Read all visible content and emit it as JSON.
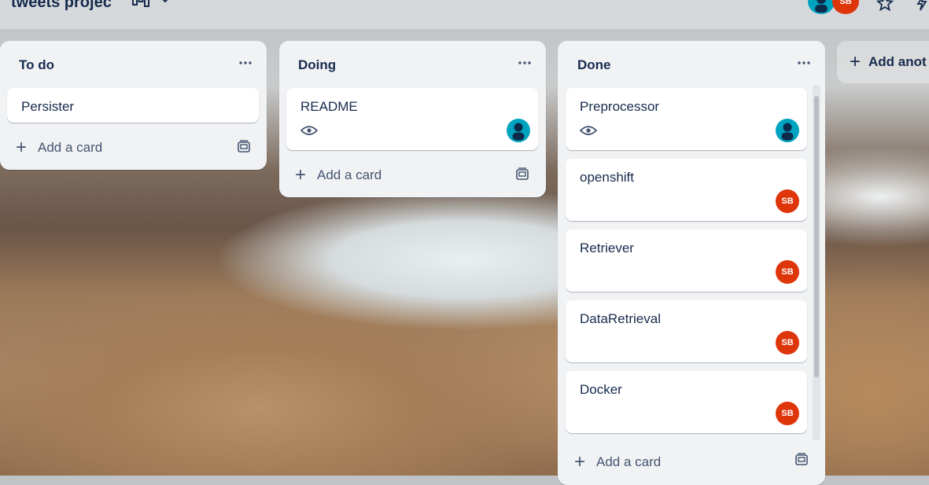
{
  "header": {
    "board_title": "tweets projec",
    "view_icon": "board-view-icon",
    "chevron_icon": "chevron-down-icon",
    "avatars": [
      {
        "initials": "",
        "icon": "person-avatar-icon"
      },
      {
        "initials": "SB"
      }
    ],
    "star_icon": "star-icon",
    "automation_icon": "bolt-icon"
  },
  "lists": [
    {
      "title": "To do",
      "cards": [
        {
          "title": "Persister"
        }
      ],
      "add_card_label": "Add a card"
    },
    {
      "title": "Doing",
      "cards": [
        {
          "title": "README",
          "watched": true,
          "member": "person-avatar-icon"
        }
      ],
      "add_card_label": "Add a card"
    },
    {
      "title": "Done",
      "cards": [
        {
          "title": "Preprocessor",
          "watched": true,
          "member": "person-avatar-icon"
        },
        {
          "title": "openshift",
          "member": "SB"
        },
        {
          "title": "Retriever",
          "member": "SB"
        },
        {
          "title": "DataRetrieval",
          "member": "SB"
        },
        {
          "title": "Docker",
          "member": "SB"
        }
      ],
      "add_card_label": "Add a card"
    }
  ],
  "add_list_label": "Add anot",
  "colors": {
    "list_bg": "#f1f2f4",
    "card_bg": "#ffffff",
    "avatar_sb": "#de350b",
    "avatar_person": "#00a3bf",
    "text": "#172b4d"
  }
}
